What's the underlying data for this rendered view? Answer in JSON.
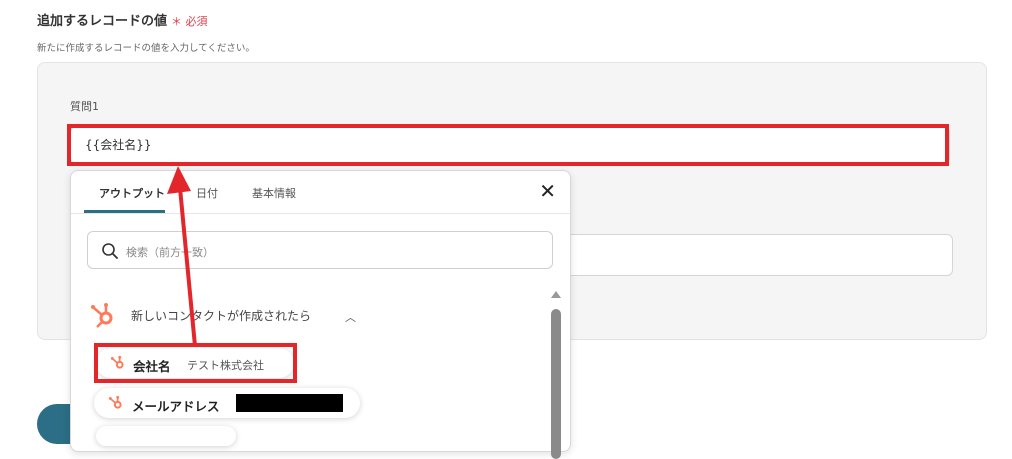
{
  "section": {
    "title": "追加するレコードの値",
    "required": "＊ 必須",
    "description": "新たに作成するレコードの値を入力してください。"
  },
  "field": {
    "label": "質問1",
    "value": "{{会社名}}"
  },
  "popup": {
    "tabs": [
      "アウトプット",
      "日付",
      "基本情報"
    ],
    "active_tab": "アウトプット",
    "search_placeholder": "検索（前方一致）",
    "group": "新しいコンタクトが作成されたら",
    "items": [
      {
        "name": "会社名",
        "value": "テスト株式会社"
      },
      {
        "name": "メールアドレス",
        "value": ""
      }
    ],
    "icons": [
      "close-icon",
      "search-icon",
      "hubspot-icon",
      "chevron-up-icon",
      "scroll-up-icon"
    ]
  },
  "colors": {
    "highlight": "#e3262a",
    "accent": "#2b6e85",
    "hubspot": "#ff7a59",
    "required": "#e0404a"
  }
}
